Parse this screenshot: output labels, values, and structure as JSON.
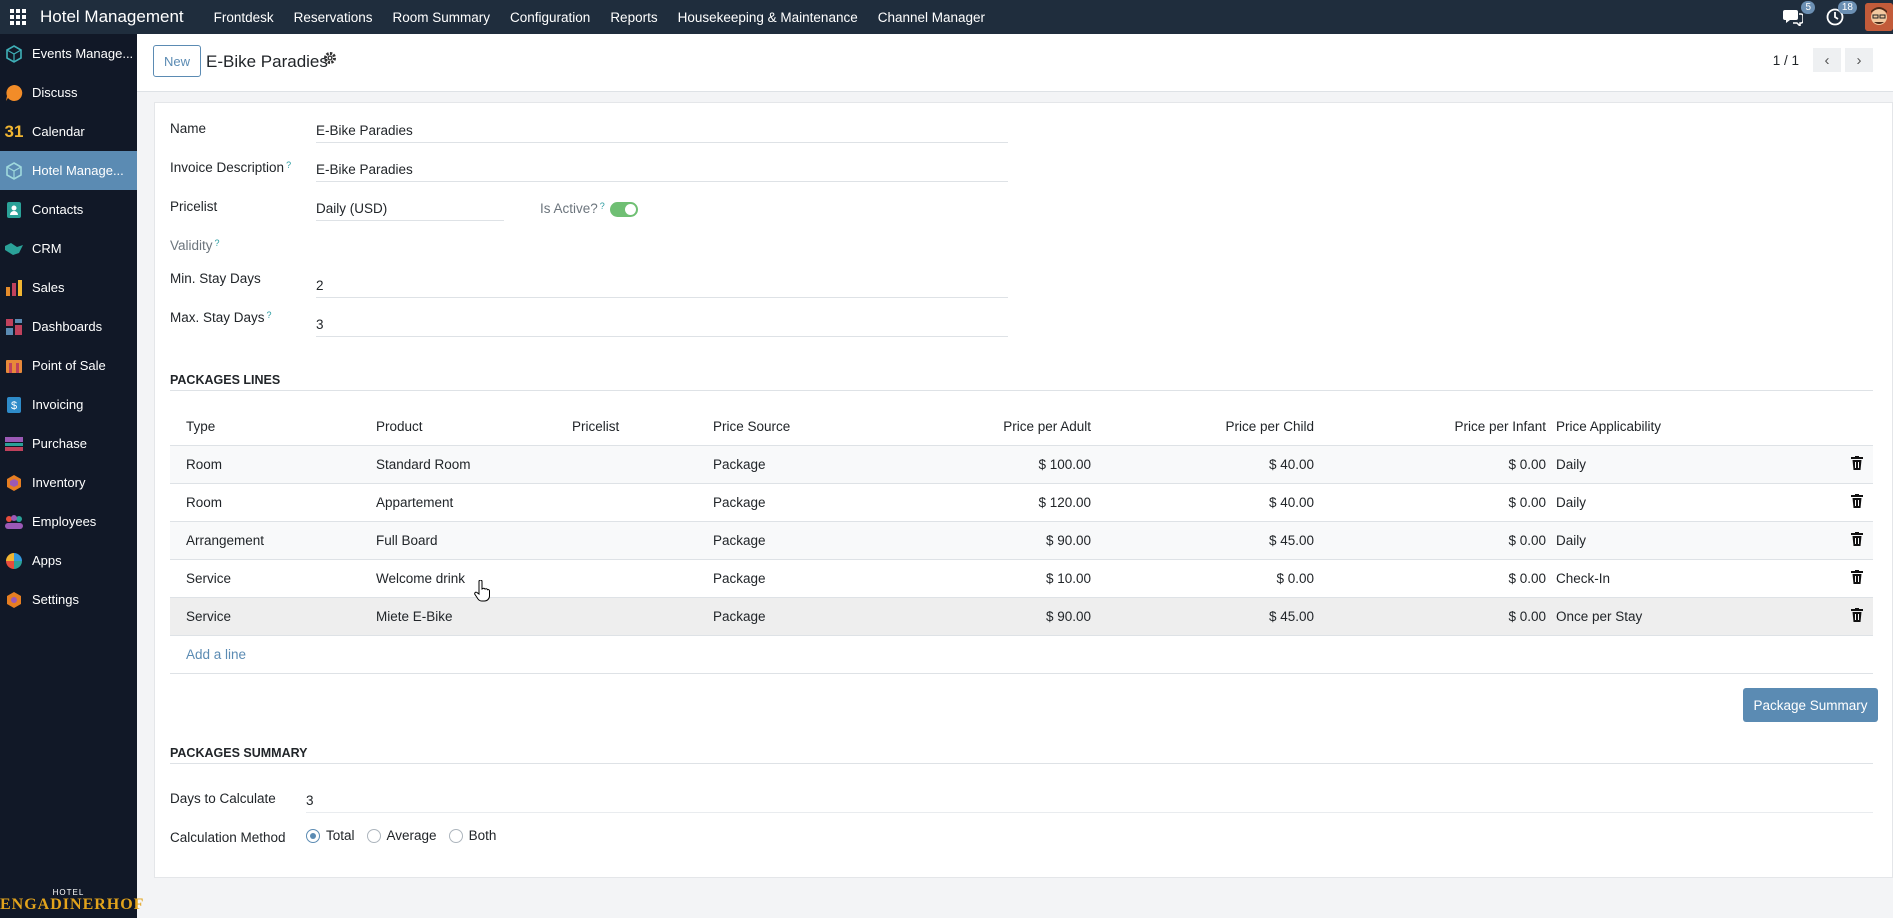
{
  "topbar": {
    "brand": "Hotel Management",
    "menu": [
      "Frontdesk",
      "Reservations",
      "Room Summary",
      "Configuration",
      "Reports",
      "Housekeeping & Maintenance",
      "Channel Manager"
    ],
    "messages_count": "5",
    "activities_count": "18"
  },
  "sidebar": {
    "items": [
      {
        "label": "Events Manage...",
        "icon": "events-icon",
        "color": "#3fb0b8"
      },
      {
        "label": "Discuss",
        "icon": "discuss-icon",
        "color": "#f28c28"
      },
      {
        "label": "Calendar",
        "icon": "calendar-icon",
        "color": "#f2b632"
      },
      {
        "label": "Hotel Manage...",
        "icon": "hotel-icon",
        "color": "#3fb0b8"
      },
      {
        "label": "Contacts",
        "icon": "contacts-icon",
        "color": "#2aa198"
      },
      {
        "label": "CRM",
        "icon": "crm-icon",
        "color": "#2aa198"
      },
      {
        "label": "Sales",
        "icon": "sales-icon",
        "color": "#e58c2b"
      },
      {
        "label": "Dashboards",
        "icon": "dashboards-icon",
        "color": "#c0415c"
      },
      {
        "label": "Point of Sale",
        "icon": "pos-icon",
        "color": "#e8893a"
      },
      {
        "label": "Invoicing",
        "icon": "invoicing-icon",
        "color": "#2e8bc9"
      },
      {
        "label": "Purchase",
        "icon": "purchase-icon",
        "color": "#9b59b6"
      },
      {
        "label": "Inventory",
        "icon": "inventory-icon",
        "color": "#e67e22"
      },
      {
        "label": "Employees",
        "icon": "employees-icon",
        "color": "#e74c3c"
      },
      {
        "label": "Apps",
        "icon": "apps-icon",
        "color": "#3498db"
      },
      {
        "label": "Settings",
        "icon": "settings-icon",
        "color": "#e67e22"
      }
    ],
    "calendar_number": "31",
    "logo_small": "HOTEL",
    "logo_big": "ENGADINERHOF"
  },
  "control": {
    "new_label": "New",
    "title": "E-Bike Paradies",
    "pager": "1 / 1"
  },
  "form": {
    "name_label": "Name",
    "name_value": "E-Bike Paradies",
    "invoice_desc_label": "Invoice Description",
    "invoice_desc_value": "E-Bike Paradies",
    "pricelist_label": "Pricelist",
    "pricelist_value": "Daily (USD)",
    "is_active_label": "Is Active?",
    "is_active": true,
    "validity_label": "Validity",
    "min_stay_label": "Min. Stay Days",
    "min_stay_value": "2",
    "max_stay_label": "Max. Stay Days",
    "max_stay_value": "3",
    "help_mark": "?"
  },
  "lines": {
    "section_title": "PACKAGES LINES",
    "headers": [
      "Type",
      "Product",
      "Pricelist",
      "Price Source",
      "Price per Adult",
      "Price per Child",
      "Price per Infant",
      "Price Applicability"
    ],
    "rows": [
      {
        "type": "Room",
        "product": "Standard Room",
        "pricelist": "",
        "source": "Package",
        "adult": "$ 100.00",
        "child": "$ 40.00",
        "infant": "$ 0.00",
        "applicability": "Daily"
      },
      {
        "type": "Room",
        "product": "Appartement",
        "pricelist": "",
        "source": "Package",
        "adult": "$ 120.00",
        "child": "$ 40.00",
        "infant": "$ 0.00",
        "applicability": "Daily"
      },
      {
        "type": "Arrangement",
        "product": "Full Board",
        "pricelist": "",
        "source": "Package",
        "adult": "$ 90.00",
        "child": "$ 45.00",
        "infant": "$ 0.00",
        "applicability": "Daily"
      },
      {
        "type": "Service",
        "product": "Welcome drink",
        "pricelist": "",
        "source": "Package",
        "adult": "$ 10.00",
        "child": "$ 0.00",
        "infant": "$ 0.00",
        "applicability": "Check-In"
      },
      {
        "type": "Service",
        "product": "Miete E-Bike",
        "pricelist": "",
        "source": "Package",
        "adult": "$ 90.00",
        "child": "$ 45.00",
        "infant": "$ 0.00",
        "applicability": "Once per Stay"
      }
    ],
    "add_line": "Add a line",
    "summary_button": "Package Summary"
  },
  "summary": {
    "section_title": "PACKAGES SUMMARY",
    "days_label": "Days to Calculate",
    "days_value": "3",
    "method_label": "Calculation Method",
    "methods": [
      "Total",
      "Average",
      "Both"
    ],
    "selected_method": "Total"
  }
}
